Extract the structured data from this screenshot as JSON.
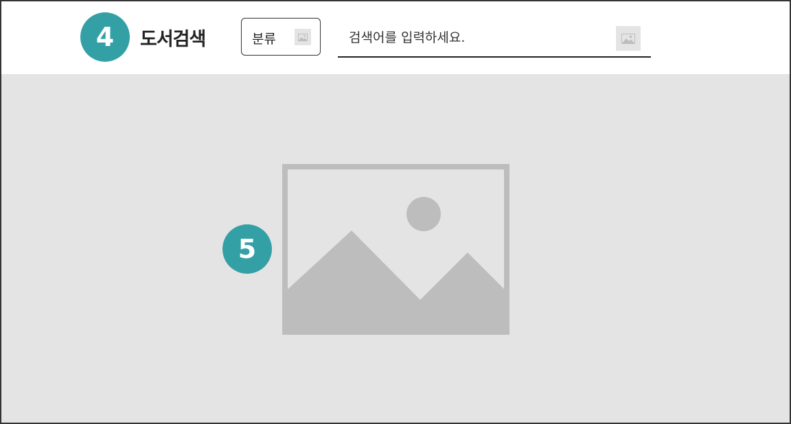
{
  "header": {
    "step_badge": "4",
    "title": "도서검색",
    "category_select": {
      "label": "분류",
      "icon": "image-placeholder-icon"
    },
    "search": {
      "placeholder": "검색어를 입력하세요.",
      "value": "",
      "icon": "image-placeholder-icon"
    }
  },
  "content": {
    "step_badge": "5",
    "image": "image-placeholder-icon"
  },
  "colors": {
    "badge": "#33a0a6",
    "content_bg": "#e4e4e4",
    "placeholder_gray": "#bdbdbd",
    "border": "#333333",
    "text": "#222222"
  }
}
